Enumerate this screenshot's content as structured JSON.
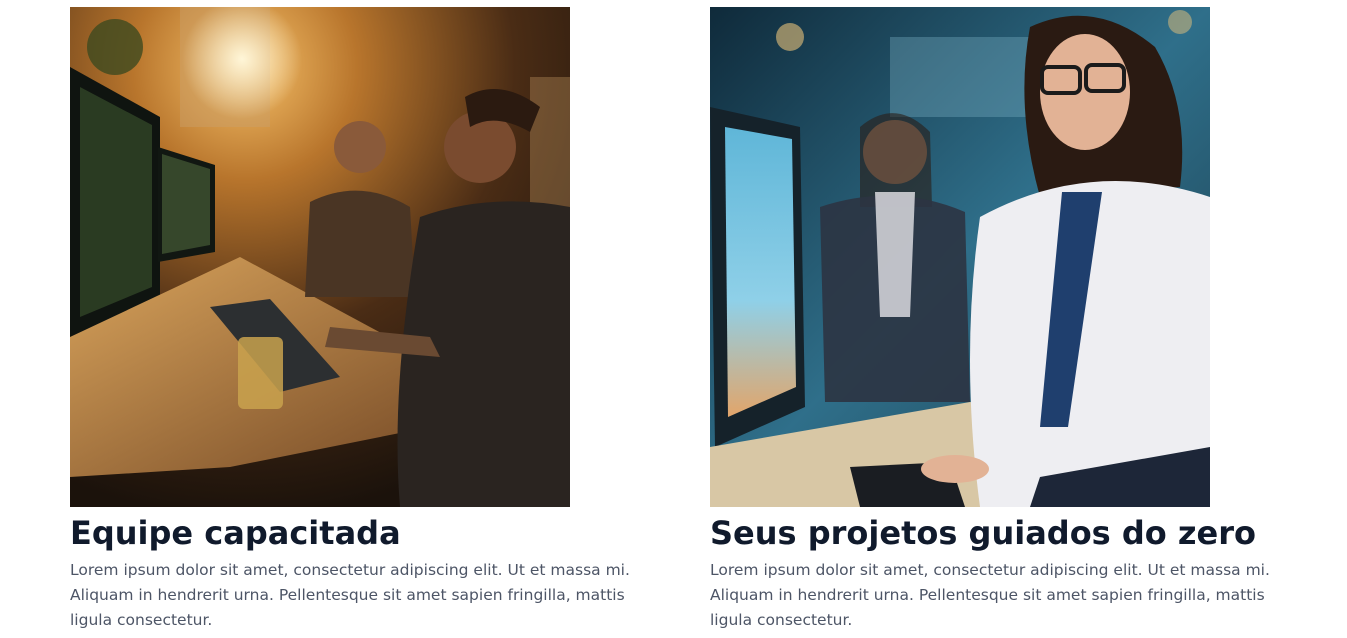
{
  "cards": [
    {
      "title": "Equipe capacitada",
      "text": "Lorem ipsum dolor sit amet, consectetur adipiscing elit. Ut et massa mi. Aliquam in hendrerit urna. Pellentesque sit amet sapien fringilla, mattis ligula consectetur.",
      "image_icon": "team-photo-icon"
    },
    {
      "title": "Seus projetos guiados do zero",
      "text": "Lorem ipsum dolor sit amet, consectetur adipiscing elit. Ut et massa mi. Aliquam in hendrerit urna. Pellentesque sit amet sapien fringilla, mattis ligula consectetur.",
      "image_icon": "guide-photo-icon"
    }
  ],
  "colors": {
    "title": "#101a2c",
    "body_text": "#4d5566",
    "background": "#ffffff"
  }
}
